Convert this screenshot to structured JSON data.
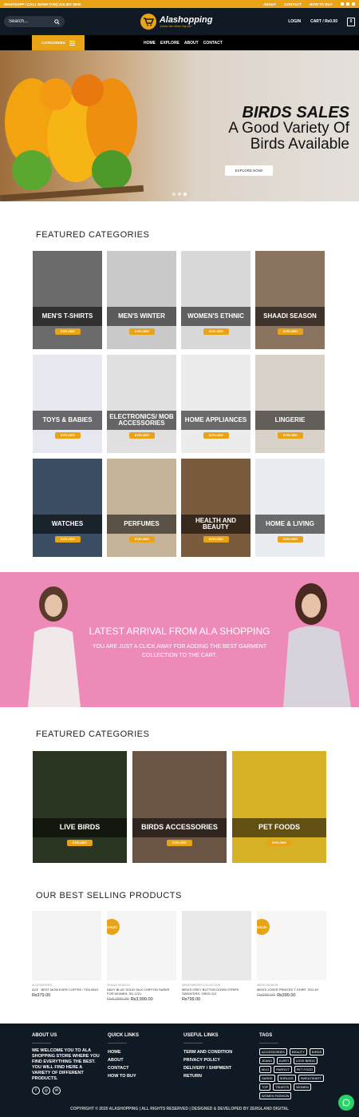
{
  "topbar": {
    "contact": "WHATSAPP / CALL NOW# (+92) 316 507 9009",
    "links": [
      "ABOUT",
      "CONTACT",
      "HOW TO BUY"
    ]
  },
  "header": {
    "search_placeholder": "Search...",
    "logo_text": "Alashopping",
    "logo_tagline": "\"yahan har cheez hay Ala\"",
    "login": "LOGIN",
    "cart": "CART / ₨0.00",
    "cart_count": "0"
  },
  "nav": {
    "categories_label": "CATEGORIES",
    "links": [
      "HOME",
      "EXPLORE",
      "ABOUT",
      "CONTACT"
    ]
  },
  "hero": {
    "title": "BIRDS SALES",
    "subtitle_line1": "A Good Variety Of",
    "subtitle_line2": "Birds Available",
    "button": "EXPLORE NOW!"
  },
  "featured1": {
    "title": "FEATURED CATEGORIES",
    "button": "EXPLORE!",
    "tiles": [
      {
        "label": "MEN'S T-SHIRTS",
        "color": "#6b6b6b"
      },
      {
        "label": "MEN'S WINTER",
        "color": "#c9c9c9"
      },
      {
        "label": "WOMEN'S ETHNIC",
        "color": "#d8d8d8"
      },
      {
        "label": "SHAADI SEASON",
        "color": "#8a7460"
      },
      {
        "label": "TOYS & BABIES",
        "color": "#e7e7ef"
      },
      {
        "label": "ELECTRONICS/ MOB ACCESSORIES",
        "color": "#e0e0e0"
      },
      {
        "label": "HOME APPLIANCES",
        "color": "#ececec"
      },
      {
        "label": "LINGERIE",
        "color": "#d9d2c8"
      },
      {
        "label": "WATCHES",
        "color": "#3b4e63"
      },
      {
        "label": "PERFUMES",
        "color": "#c6b49a"
      },
      {
        "label": "HEALTH AND BEAUTY",
        "color": "#7b5b3e"
      },
      {
        "label": "HOME & LIVING",
        "color": "#e9ecf0"
      }
    ]
  },
  "promo": {
    "heading": "LATEST ARRIVAL FROM ALA SHOPPING",
    "text": "YOU ARE JUST A CLICK AWAY FOR ADDING THE BEST GARMENT COLLECTION TO THE CART."
  },
  "featured2": {
    "title": "FEATURED CATEGORIES",
    "button": "EXPLORE!",
    "tiles": [
      {
        "label": "LIVE BIRDS",
        "color": "#2a3522"
      },
      {
        "label": "BIRDS ACCESSORIES",
        "color": "#6a5545"
      },
      {
        "label": "PET FOODS",
        "color": "#d8b226"
      }
    ]
  },
  "bestselling": {
    "title": "OUR BEST SELLING PRODUCTS",
    "products": [
      {
        "category": "ACCESSORIES",
        "name": "ACE . BEST MOM EVER COFFEE / TEA MUG",
        "price": "₨379.00",
        "old_price": "",
        "sale": false
      },
      {
        "category": "SHAADI SEASON",
        "name": "NAVY BLUE SOLID SILK CHIFFON SAREE FOR WOMEN. SD-1221",
        "price": "₨3,999.00",
        "old_price": "₨6,999.00",
        "sale": true
      },
      {
        "category": "MENS WINTER COLLECTION",
        "name": "MEN'S GREY BUTTON DOWN STRIPE SWEATERS. GBSS-112",
        "price": "₨799.00",
        "old_price": "",
        "sale": false
      },
      {
        "category": "MENS FASHION",
        "name": "MEN'S JOKER PRINTED T-SHIRT. SS2-AY",
        "price": "₨399.00",
        "old_price": "₨699.00",
        "sale": true
      }
    ],
    "sale_label": "SALE!"
  },
  "footer": {
    "about_title": "ABOUT US",
    "about_text": "WE WELCOME YOU TO ALA SHOPPING STORE WHERE YOU FIND EVERYTHING THE BEST. YOU WILL FIND HERE A VARIETY OF DIFFERENT PRODUCTS.",
    "quick_title": "QUICK LINKS",
    "quick_links": [
      "HOME",
      "ABOUT",
      "CONTACT",
      "HOW TO BUY"
    ],
    "useful_title": "USEFUL LINKS",
    "useful_links": [
      "TERM AND CONDITION",
      "PRIVACY POLICY",
      "DELIVERY / SHIPMENT",
      "RETURN"
    ],
    "tags_title": "TAGS",
    "tags": [
      "ACCESSORIES",
      "BEAUTY",
      "BIRDS",
      "JEANS",
      "KURTI",
      "LOVE BIRDS",
      "MUG",
      "PARROT",
      "PET FOOD",
      "SAREE",
      "SHRUGS",
      "SWEATSHIRT",
      "TOP",
      "TSHIRTS",
      "WOMEN",
      "WOMEN FASHION"
    ],
    "copyright": "COPYRIGHT © 2020 ALASHOPPING | ALL RIGHTS RESERVED | DESIGNED & DEVELOPED BY ZERGLAND DIGITAL"
  }
}
